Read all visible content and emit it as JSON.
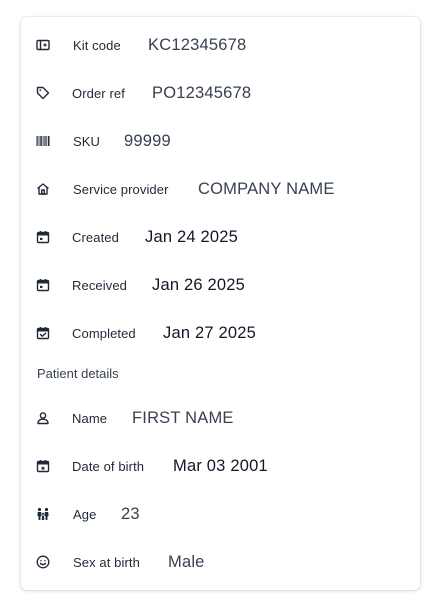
{
  "details": {
    "kit_code": {
      "icon": "kit-icon",
      "label": "Kit code",
      "value": "KC12345678"
    },
    "order_ref": {
      "icon": "tag-icon",
      "label": "Order ref",
      "value": "PO12345678"
    },
    "sku": {
      "icon": "barcode-icon",
      "label": "SKU",
      "value": "99999"
    },
    "service_provider": {
      "icon": "home-icon",
      "label": "Service provider",
      "value": "COMPANY NAME"
    },
    "created": {
      "icon": "calendar-icon",
      "label": "Created",
      "value": "Jan 24 2025"
    },
    "received": {
      "icon": "calendar-icon",
      "label": "Received",
      "value": "Jan 26 2025"
    },
    "completed": {
      "icon": "calendar-check-icon",
      "label": "Completed",
      "value": "Jan 27 2025"
    }
  },
  "patient": {
    "section_title": "Patient details",
    "name": {
      "icon": "user-icon",
      "label": "Name",
      "value": "FIRST NAME"
    },
    "dob": {
      "icon": "calendar-star-icon",
      "label": "Date of birth",
      "value": "Mar 03 2001"
    },
    "age": {
      "icon": "people-icon",
      "label": "Age",
      "value": "23"
    },
    "sex": {
      "icon": "smiley-icon",
      "label": "Sex at birth",
      "value": "Male"
    }
  },
  "colors": {
    "label": "#1f2937",
    "value_dark": "#111827",
    "value_light": "#374151",
    "icon": "#1f2937"
  }
}
